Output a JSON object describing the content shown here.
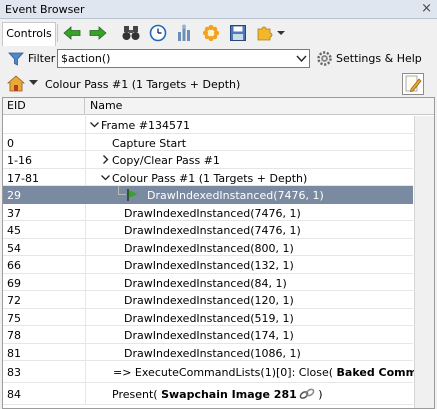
{
  "window": {
    "title": "Event Browser",
    "close_glyph": "×"
  },
  "toolbar": {
    "tab_label": "Controls",
    "icons": [
      "green-left-arrow-icon",
      "green-right-arrow-icon",
      "binoculars-icon",
      "clock-icon",
      "bar-chart-icon",
      "gear-flower-icon",
      "save-disk-icon",
      "puzzle-icon",
      "dropdown-caret-icon"
    ]
  },
  "filter": {
    "label": "Filter",
    "value": "$action()",
    "settings_label": "Settings & Help"
  },
  "breadcrumb": {
    "path": "Colour Pass #1 (1 Targets + Depth)"
  },
  "table": {
    "col_eid": "EID",
    "col_name": "Name",
    "rows": [
      {
        "eid": "",
        "name": "Frame #134571"
      },
      {
        "eid": "0",
        "name": "Capture Start"
      },
      {
        "eid": "1-16",
        "name": "Copy/Clear Pass #1"
      },
      {
        "eid": "17-81",
        "name": "Colour Pass #1 (1 Targets + Depth)"
      },
      {
        "eid": "29",
        "name": "DrawIndexedInstanced(7476, 1)"
      },
      {
        "eid": "37",
        "name": "DrawIndexedInstanced(7476, 1)"
      },
      {
        "eid": "45",
        "name": "DrawIndexedInstanced(7476, 1)"
      },
      {
        "eid": "54",
        "name": "DrawIndexedInstanced(800, 1)"
      },
      {
        "eid": "66",
        "name": "DrawIndexedInstanced(132, 1)"
      },
      {
        "eid": "69",
        "name": "DrawIndexedInstanced(84, 1)"
      },
      {
        "eid": "72",
        "name": "DrawIndexedInstanced(120, 1)"
      },
      {
        "eid": "75",
        "name": "DrawIndexedInstanced(519, 1)"
      },
      {
        "eid": "78",
        "name": "DrawIndexedInstanced(174, 1)"
      },
      {
        "eid": "81",
        "name": "DrawIndexedInstanced(1086, 1)"
      },
      {
        "eid": "83",
        "name_prefix": "=> ExecuteCommandLists(1)[0]: Close( ",
        "name_bold": "Baked Command Li"
      },
      {
        "eid": "84",
        "name_prefix": "Present( ",
        "name_bold": "Swapchain Image 281",
        "name_suffix": " )"
      }
    ]
  },
  "colors": {
    "selected_row": "#7a8aa0",
    "title_bg": "#dfe6ef",
    "flag_green": "#3aa02c"
  }
}
